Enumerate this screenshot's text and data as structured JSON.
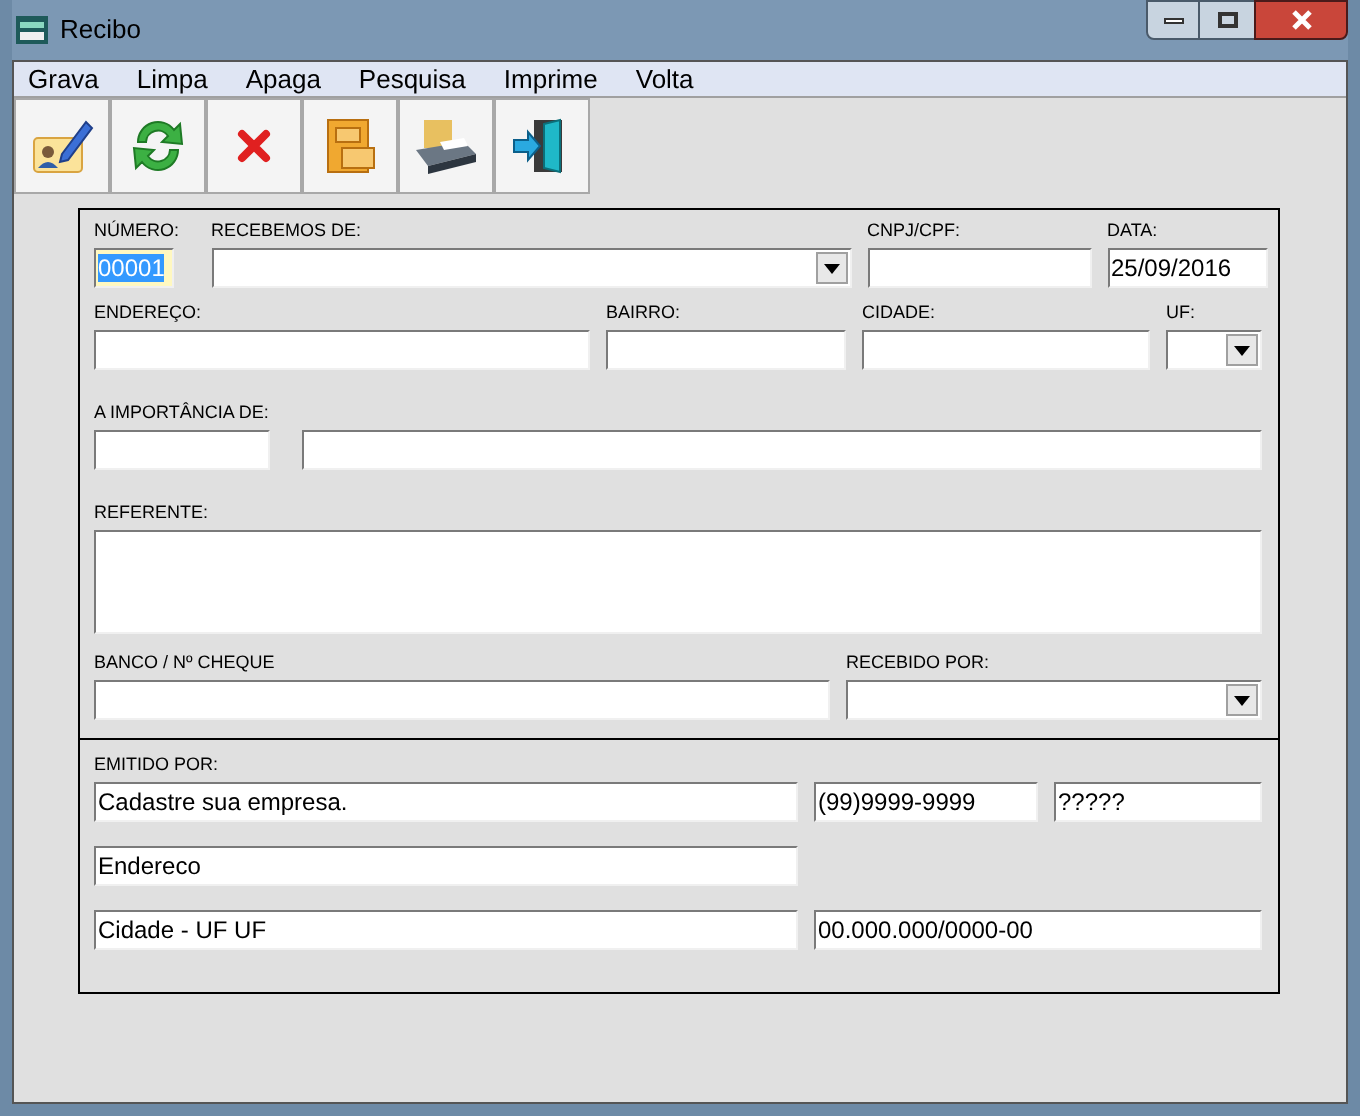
{
  "window": {
    "title": "Recibo"
  },
  "menu": [
    "Grava",
    "Limpa",
    "Apaga",
    "Pesquisa",
    "Imprime",
    "Volta"
  ],
  "toolbar": [
    {
      "kind": "edit"
    },
    {
      "kind": "refresh"
    },
    {
      "kind": "delete"
    },
    {
      "kind": "cabinet"
    },
    {
      "kind": "print"
    },
    {
      "kind": "exit"
    }
  ],
  "form": {
    "lines": [
      {
        "fields": [
          {
            "label": "NÚMERO:",
            "value": "00001",
            "kind": "text",
            "focused": true
          },
          {
            "label": "RECEBEMOS DE:",
            "kind": "combo",
            "focused": false
          },
          {
            "label": "CNPJ/CPF:",
            "kind": "text",
            "focused": false
          },
          {
            "label": "DATA:",
            "value": "25/09/2016",
            "kind": "text",
            "focused": false
          }
        ]
      },
      {
        "fields": [
          {
            "label": "ENDEREÇO:",
            "kind": "text",
            "focused": false
          },
          {
            "label": "BAIRRO:",
            "kind": "text",
            "focused": false
          },
          {
            "label": "CIDADE:",
            "kind": "text",
            "focused": false
          },
          {
            "label": "UF:",
            "kind": "combo",
            "focused": false
          }
        ]
      },
      {
        "fields": [
          {
            "label": "A IMPORTÂNCIA DE:",
            "kind": "text",
            "focused": false
          },
          {
            "kind": "text",
            "focused": false
          }
        ]
      },
      {
        "fields": [
          {
            "label": "REFERENTE:",
            "kind": "area",
            "focused": false
          }
        ]
      },
      {
        "fields": [
          {
            "label": "BANCO / Nº CHEQUE",
            "kind": "text",
            "focused": false
          },
          {
            "label": "RECEBIDO POR:",
            "kind": "combo",
            "focused": false
          }
        ]
      }
    ]
  },
  "issuer": {
    "label": "EMITIDO POR:",
    "rows": [
      [
        {
          "value": "Cadastre sua empresa.",
          "kind": "text",
          "focused": false
        },
        {
          "value": "(99)9999-9999",
          "kind": "text",
          "focused": false
        },
        {
          "value": "?????",
          "kind": "text",
          "focused": false
        }
      ],
      [
        {
          "value": "Endereco",
          "kind": "text",
          "focused": false
        }
      ],
      [
        {
          "value": "Cidade - UF  UF",
          "kind": "text",
          "focused": false
        },
        {
          "value": "00.000.000/0000-00",
          "kind": "text",
          "focused": false
        }
      ]
    ]
  }
}
